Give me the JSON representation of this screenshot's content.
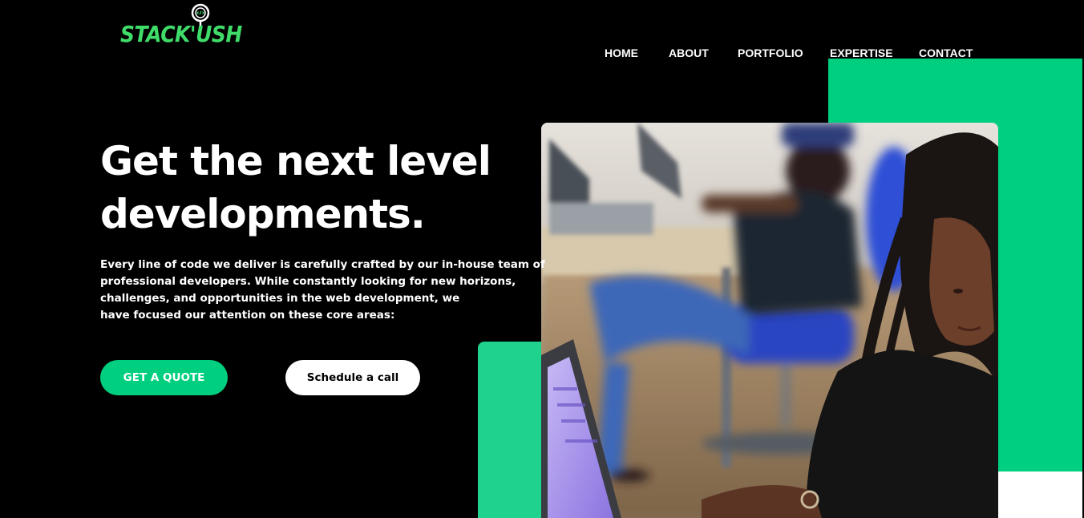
{
  "logo": {
    "text": "STACK'USH",
    "brand_color": "#3fdc6a"
  },
  "nav": {
    "items": [
      {
        "label": "HOME"
      },
      {
        "label": "ABOUT"
      },
      {
        "label": "PORTFOLIO"
      },
      {
        "label": "EXPERTISE"
      },
      {
        "label": "CONTACT"
      }
    ]
  },
  "hero": {
    "title_line1": "Get the next level",
    "title_line2": "developments.",
    "description_lines": [
      "Every line of code we deliver is carefully crafted by our in-house team of",
      "professional developers. While constantly looking for new horizons,",
      "challenges, and opportunities in the web development, we",
      "have focused our attention on these core areas:"
    ],
    "primary_button": "GET A QUOTE",
    "secondary_button": "Schedule a call",
    "image": "photo of developers working at laptops in an office"
  },
  "colors": {
    "accent_green": "#00cf7f",
    "accent_green_light": "#1fd38f",
    "background": "#000000"
  },
  "icons": {
    "logo_icon": "code-bubble-icon"
  }
}
